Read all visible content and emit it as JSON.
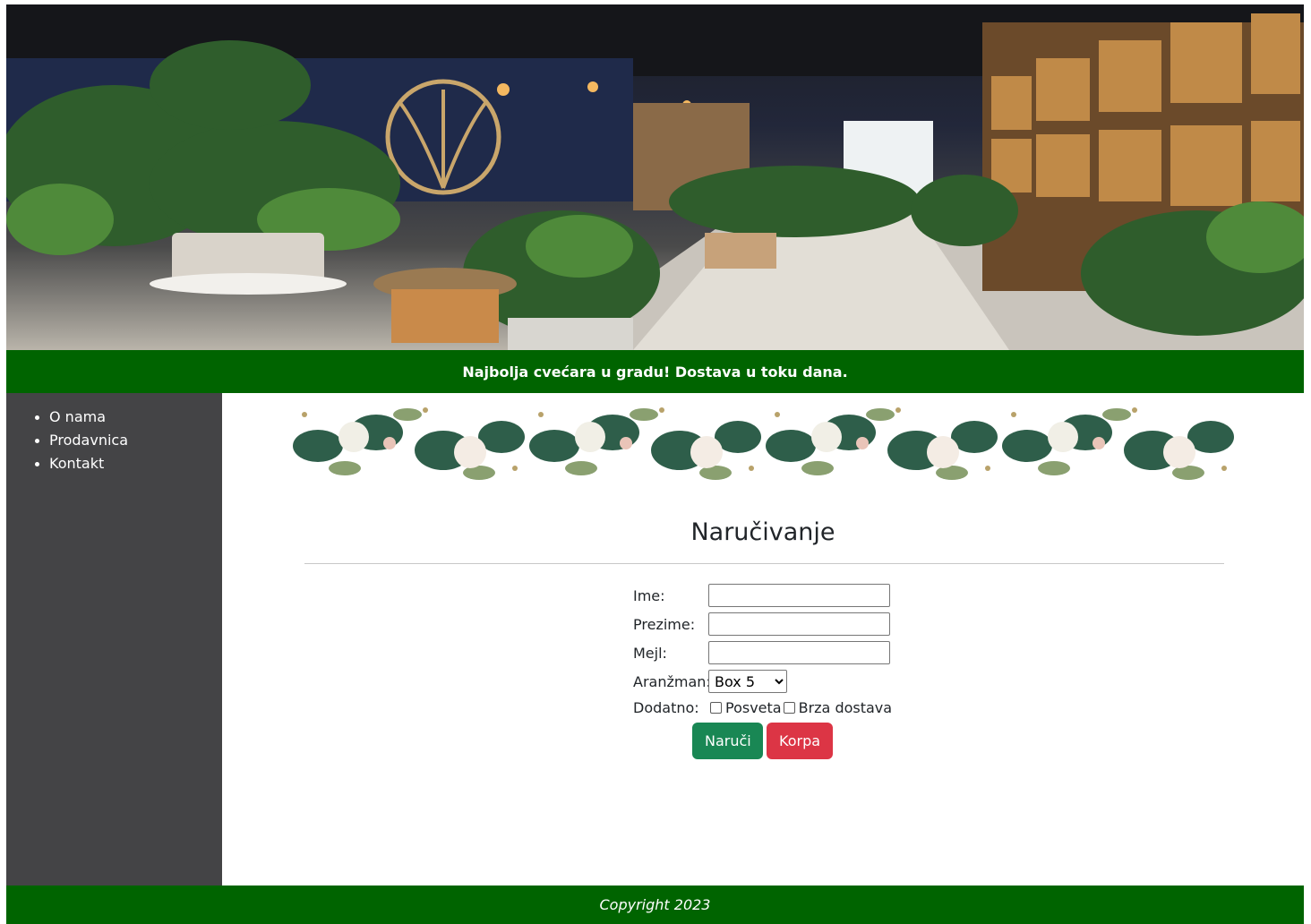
{
  "hero": {
    "image_alt": ""
  },
  "banner": {
    "text": "Najbolja cvećara u gradu! Dostava u toku dana."
  },
  "sidebar": {
    "items": [
      {
        "label": "O nama"
      },
      {
        "label": "Prodavnica"
      },
      {
        "label": "Kontakt"
      }
    ]
  },
  "main": {
    "title": "Naručivanje",
    "form": {
      "ime_label": "Ime:",
      "ime_value": "",
      "prezime_label": "Prezime:",
      "prezime_value": "",
      "mejl_label": "Mejl:",
      "mejl_value": "",
      "aranzman_label": "Aranžman:",
      "aranzman_selected": "Box 5",
      "dodatno_label": "Dodatno:",
      "posveta_label": "Posveta",
      "brza_dostava_label": "Brza dostava",
      "naruci_label": "Naruči",
      "korpa_label": "Korpa"
    }
  },
  "footer": {
    "text": "Copyright 2023"
  },
  "colors": {
    "green_bar": "#006400",
    "sidebar_bg": "#444446",
    "button_green": "#198754",
    "button_red": "#dc3545"
  }
}
